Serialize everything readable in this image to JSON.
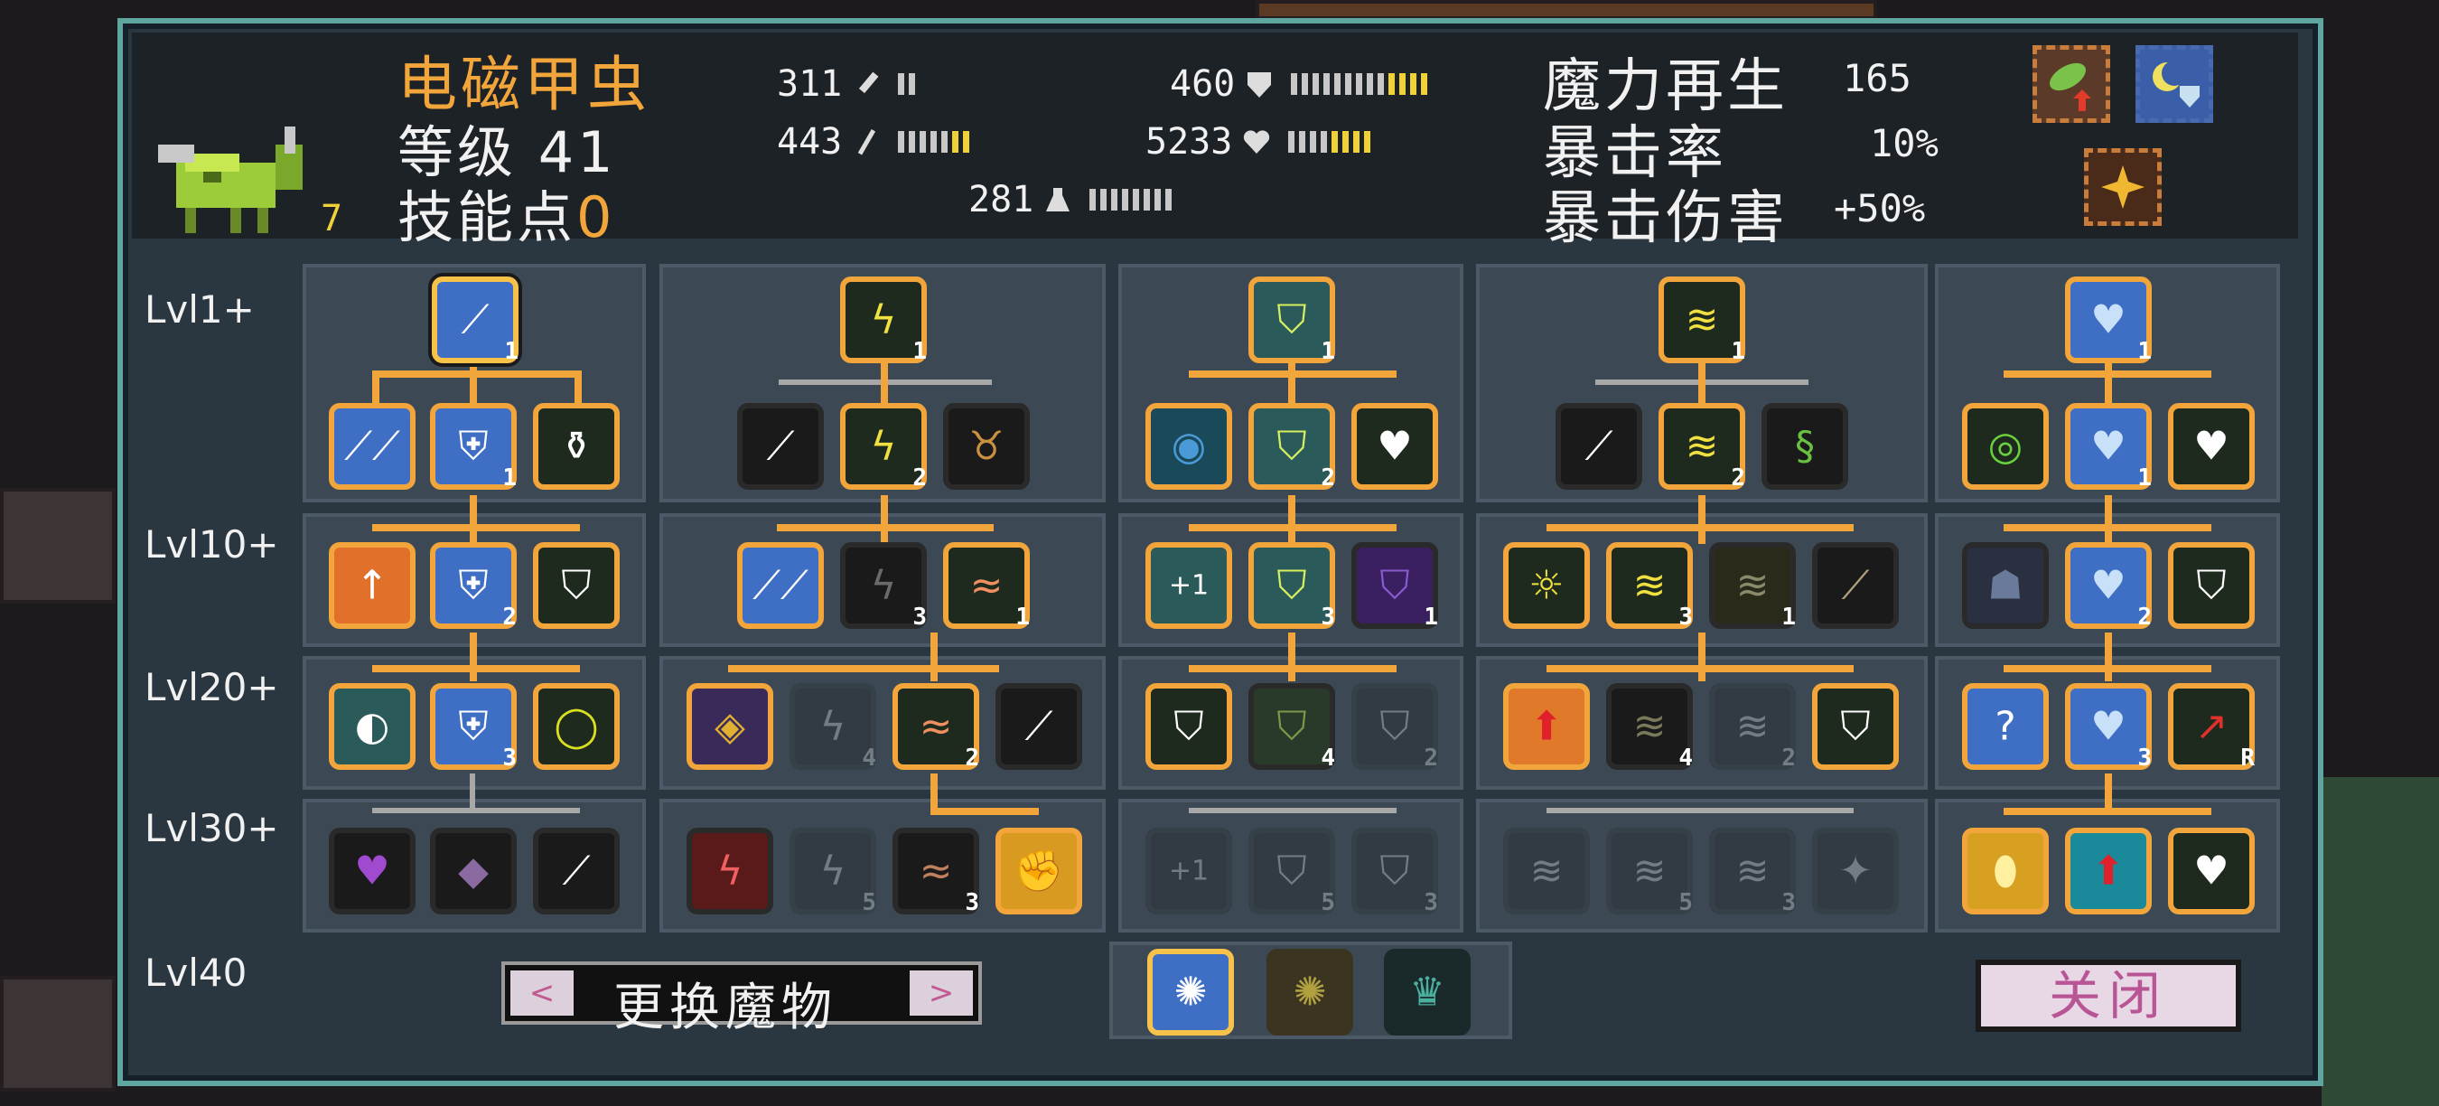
{
  "monster": {
    "name": "电磁甲虫",
    "level_label": "等级 41",
    "skill_points_label": "技能点",
    "skill_points_value": "0"
  },
  "stats": {
    "attack": "311",
    "magic_attack": "443",
    "defense": "460",
    "health": "5233",
    "mana": "281"
  },
  "secondary": {
    "mana_regen_label": "魔力再生",
    "mana_regen_value": "165",
    "crit_rate_label": "暴击率",
    "crit_rate_value": "10%",
    "crit_dmg_label": "暴击伤害",
    "crit_dmg_value": "+50%"
  },
  "rows": {
    "r1": "Lvl1+",
    "r2": "Lvl10+",
    "r3": "Lvl20+",
    "r4": "Lvl30+",
    "r5": "Lvl40"
  },
  "badges": {
    "n1": "1",
    "n2": "2",
    "n3": "3",
    "n4": "4",
    "n5": "5",
    "plus1": "+1",
    "r": "R"
  },
  "footer": {
    "swap_label": "更换魔物",
    "prev": "<",
    "next": ">",
    "close_label": "关闭"
  },
  "icons": [
    "sword-icon",
    "lightning-icon",
    "shield-icon",
    "wind-icon",
    "heart-icon"
  ],
  "colors": {
    "accent": "#f2a53a",
    "frame": "#5fa6a0",
    "panel": "#3c4955"
  }
}
